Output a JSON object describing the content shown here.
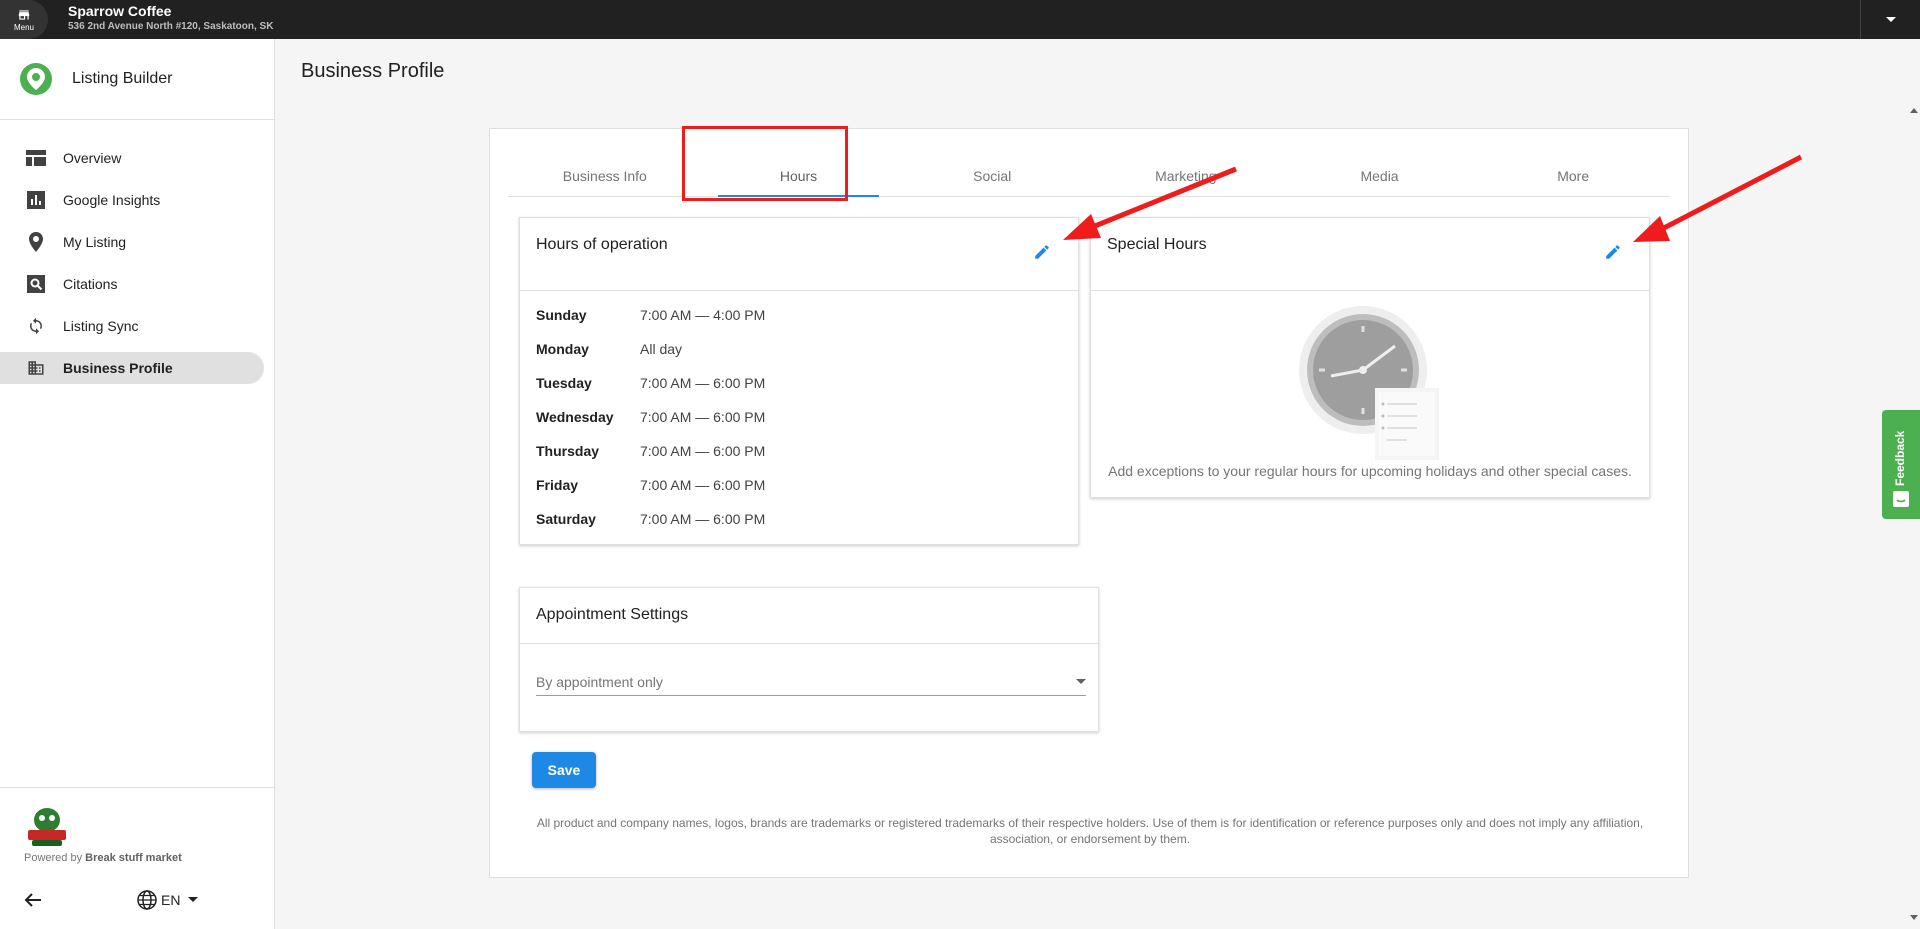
{
  "topbar": {
    "menu_label": "Menu",
    "business_name": "Sparrow Coffee",
    "business_address": "536 2nd Avenue North #120, Saskatoon, SK"
  },
  "sidebar": {
    "app_title": "Listing Builder",
    "items": [
      {
        "label": "Overview",
        "icon": "dashboard-icon"
      },
      {
        "label": "Google Insights",
        "icon": "bar-chart-icon"
      },
      {
        "label": "My Listing",
        "icon": "location-pin-icon"
      },
      {
        "label": "Citations",
        "icon": "search-box-icon"
      },
      {
        "label": "Listing Sync",
        "icon": "sync-icon"
      },
      {
        "label": "Business Profile",
        "icon": "building-icon",
        "active": true
      }
    ],
    "powered_by_prefix": "Powered by",
    "powered_by_name": "Break stuff market",
    "language": "EN"
  },
  "page": {
    "title": "Business Profile"
  },
  "tabs": [
    {
      "label": "Business Info"
    },
    {
      "label": "Hours",
      "active": true
    },
    {
      "label": "Social"
    },
    {
      "label": "Marketing"
    },
    {
      "label": "Media"
    },
    {
      "label": "More"
    }
  ],
  "hours_panel": {
    "title": "Hours of operation",
    "rows": [
      {
        "day": "Sunday",
        "time": "7:00 AM — 4:00 PM"
      },
      {
        "day": "Monday",
        "time": "All day"
      },
      {
        "day": "Tuesday",
        "time": "7:00 AM — 6:00 PM"
      },
      {
        "day": "Wednesday",
        "time": "7:00 AM — 6:00 PM"
      },
      {
        "day": "Thursday",
        "time": "7:00 AM — 6:00 PM"
      },
      {
        "day": "Friday",
        "time": "7:00 AM — 6:00 PM"
      },
      {
        "day": "Saturday",
        "time": "7:00 AM — 6:00 PM"
      }
    ]
  },
  "special_panel": {
    "title": "Special Hours",
    "description": "Add exceptions to your regular hours for upcoming holidays and other special cases."
  },
  "appointment_panel": {
    "title": "Appointment Settings",
    "selected": "By appointment only"
  },
  "save_label": "Save",
  "disclaimer": "All product and company names, logos, brands are trademarks or registered trademarks of their respective holders. Use of them is for identification or reference purposes only and does not imply any affiliation, association, or endorsement by them.",
  "feedback_label": "Feedback",
  "colors": {
    "accent": "#1e88e5",
    "highlight": "#ee1c1c",
    "brand_green": "#4caf50",
    "topbar": "#212121"
  }
}
